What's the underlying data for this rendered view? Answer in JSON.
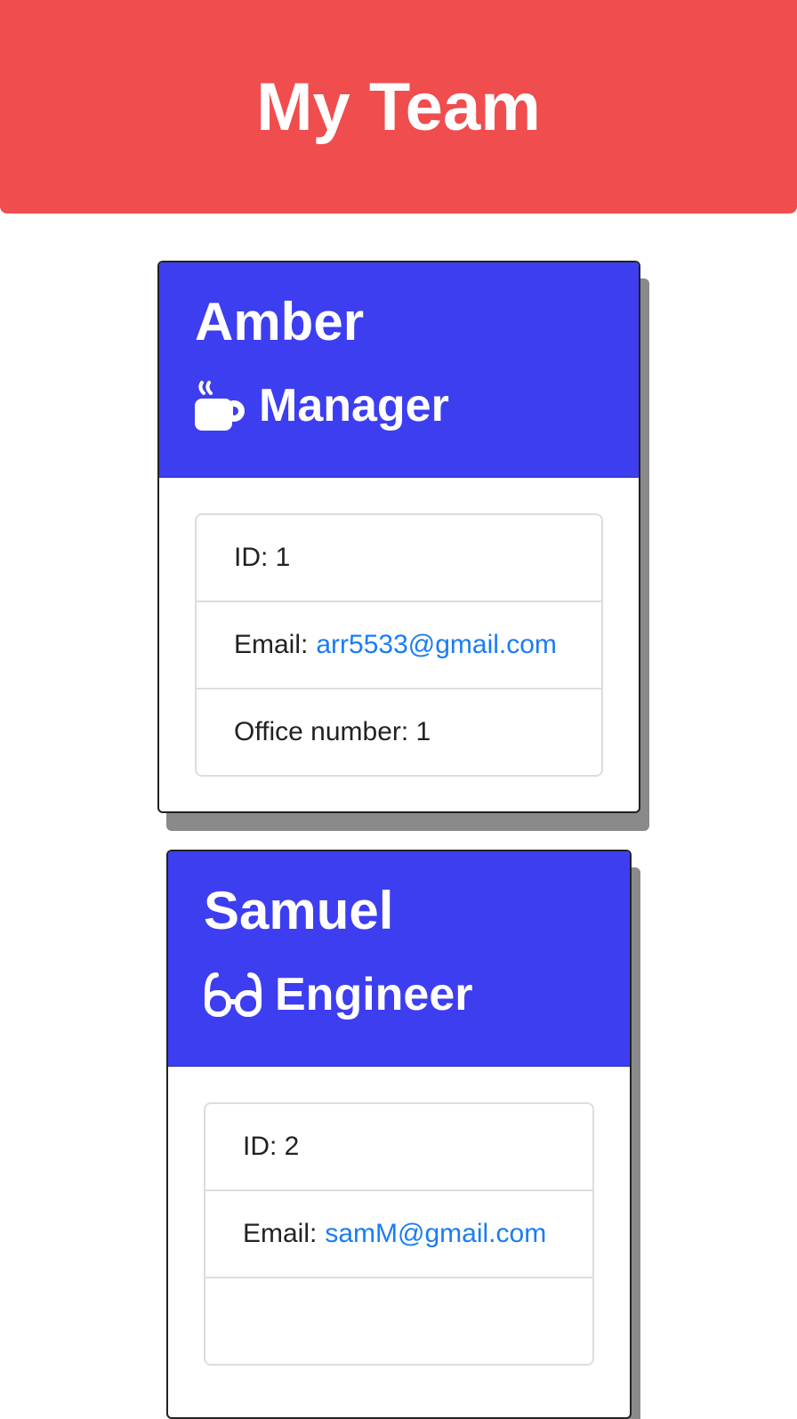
{
  "header": {
    "title": "My Team"
  },
  "employees": [
    {
      "name": "Amber",
      "role": "Manager",
      "icon": "coffee-icon",
      "id_text": "ID: 1",
      "email_label": "Email:",
      "email": "arr5533@gmail.com",
      "extra": "Office number: 1"
    },
    {
      "name": "Samuel",
      "role": "Engineer",
      "icon": "glasses-icon",
      "id_text": "ID: 2",
      "email_label": "Email:",
      "email": "samM@gmail.com"
    }
  ],
  "colors": {
    "header": "#f04d4e",
    "card_header": "#3d3ef0",
    "link": "#1a7cf5"
  }
}
